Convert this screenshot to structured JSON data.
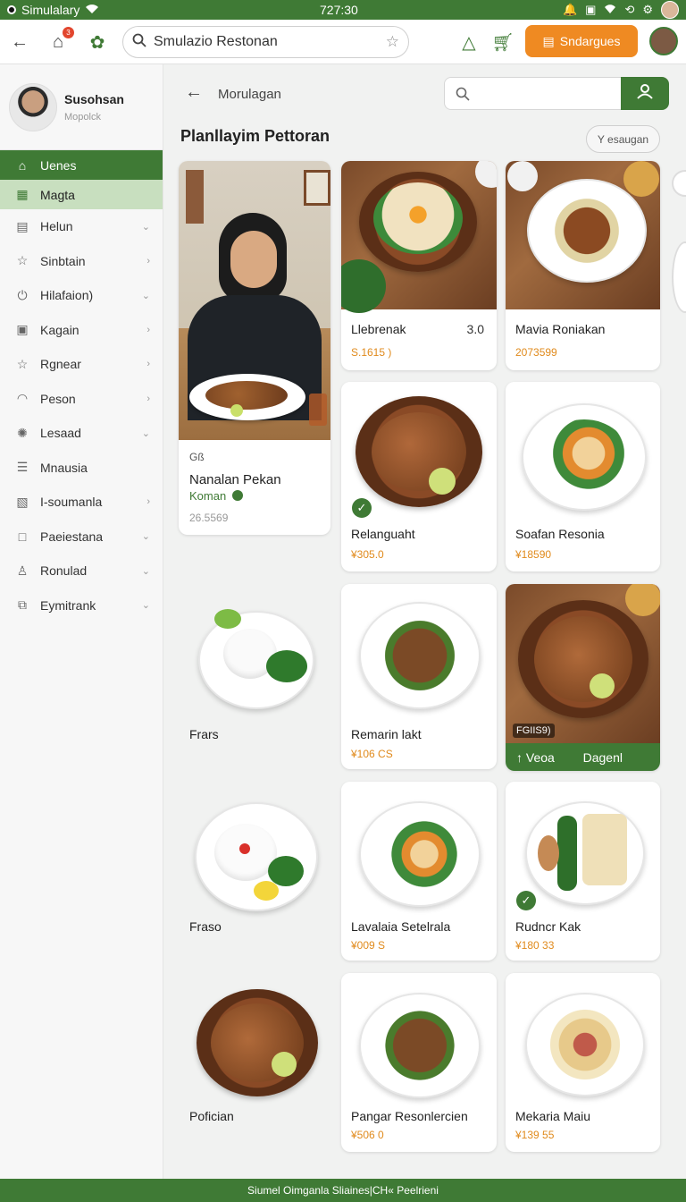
{
  "status_bar": {
    "carrier": "Simulalary",
    "time": "727:30"
  },
  "app_bar": {
    "search_placeholder": "Smulazio Restonan",
    "cta_label": "Sndargues",
    "notification_count": "3"
  },
  "sidebar": {
    "user_name": "Susohsan",
    "user_sub": "Mopolck",
    "items": [
      {
        "label": "Uenes",
        "icon": "home-icon",
        "state": "active"
      },
      {
        "label": "Magta",
        "icon": "grid-icon",
        "state": "selected"
      },
      {
        "label": "Helun",
        "icon": "list-icon"
      },
      {
        "label": "Sinbtain",
        "icon": "star-icon"
      },
      {
        "label": "Hilafaion)",
        "icon": "power-icon"
      },
      {
        "label": "Kagain",
        "icon": "calendar-icon"
      },
      {
        "label": "Rgnear",
        "icon": "star-icon"
      },
      {
        "label": "Peson",
        "icon": "person-icon"
      },
      {
        "label": "Lesaad",
        "icon": "settings-icon"
      },
      {
        "label": "Mnausia",
        "icon": "chat-icon"
      },
      {
        "label": "I-soumanla",
        "icon": "document-icon"
      },
      {
        "label": "Paeiestana",
        "icon": "box-icon"
      },
      {
        "label": "Ronulad",
        "icon": "people-icon"
      },
      {
        "label": "Eymitrank",
        "icon": "copy-icon"
      }
    ]
  },
  "main": {
    "breadcrumb": "Morulagan",
    "title": "Planllayim Pettoran",
    "filter_label": "Y esaugan",
    "featured": {
      "badge": "Gß",
      "name": "Nanalan Pekan",
      "sub": "Koman",
      "price": "26.5569"
    },
    "cards": [
      {
        "name": "Llebrenak",
        "meta": "3.0",
        "price": "S.1615 )"
      },
      {
        "name": "Mavia Roniakan",
        "price": "2073599"
      },
      {
        "name": "Relanguaht",
        "price": "¥305.0"
      },
      {
        "name": "Soafan Resonia",
        "price": "¥18590"
      },
      {
        "name": "Remarin lakt",
        "price": "¥106 CS"
      },
      {
        "name": "Lavalaia Setelrala",
        "price": "¥009 S"
      },
      {
        "name": "Rudncr Kak",
        "price": "¥180 33"
      },
      {
        "name": "Pangar Resonlercien",
        "price": "¥506 0"
      },
      {
        "name": "Mekaria Maiu",
        "price": "¥139 55"
      }
    ],
    "promo": {
      "tag": "FGIIS9)",
      "left": "Veoa",
      "right": "Dagenl"
    },
    "loose_items": [
      "Frars",
      "Fraso",
      "Pofician"
    ]
  },
  "footer": {
    "text": "Siumel Oimganla Sliaines|CH« Peelrieni"
  },
  "colors": {
    "brand_green": "#3f7a35",
    "accent_orange": "#ef8a22",
    "price_orange": "#e08a1c"
  }
}
